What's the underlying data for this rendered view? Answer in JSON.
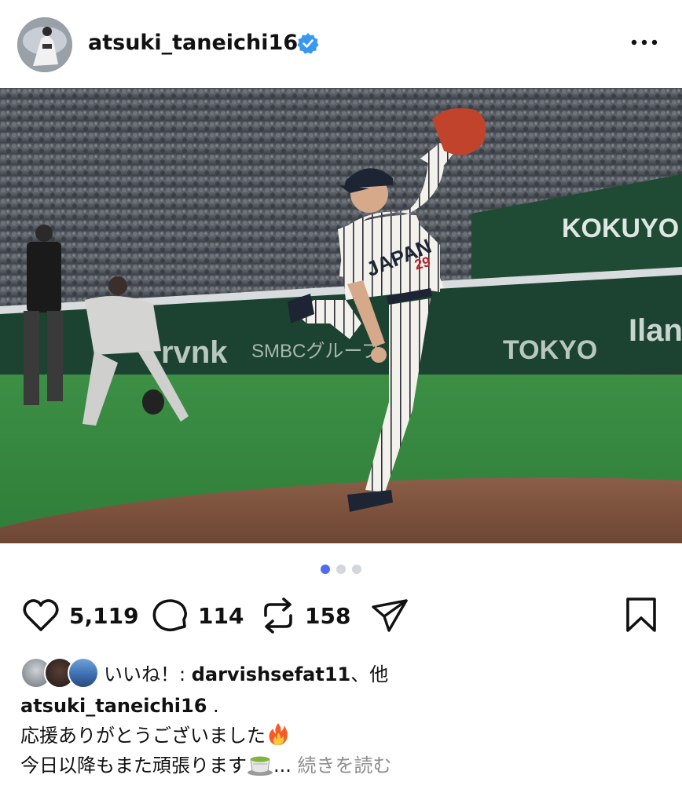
{
  "post": {
    "username": "atsuki_taneichi16",
    "verified": true
  },
  "photo": {
    "signage": {
      "board_brand": "KOKUYO",
      "board_left": "rvnk",
      "board_mid": "SMBCグループ",
      "board_right": "TOKYO",
      "board_far": "Ilan"
    },
    "jersey_text": "JAPAN",
    "jersey_number": "29"
  },
  "carousel": {
    "total": 3,
    "active_index": 0
  },
  "actions": {
    "likes_count": "5,119",
    "comments_count": "114",
    "reposts_count": "158"
  },
  "likes": {
    "prefix": "いいね！: ",
    "user": "darvishsefat11",
    "suffix": "、他"
  },
  "caption": {
    "username": "atsuki_taneichi16",
    "first_line_rest": " .",
    "line2": "応援ありがとうございました",
    "line3": "今日以降もまた頑張ります",
    "ellipsis": "... ",
    "read_more": "続きを読む"
  },
  "colors": {
    "verified_blue": "#3897f0",
    "dot_active": "#4d6cf2",
    "dot_inactive": "#d3d6da",
    "muted_text": "#8e8e8e"
  },
  "icons": [
    "verified-badge-icon",
    "more-options-icon",
    "heart-icon",
    "comment-icon",
    "repost-icon",
    "share-icon",
    "bookmark-icon",
    "fire-emoji-icon",
    "tea-emoji-icon"
  ]
}
